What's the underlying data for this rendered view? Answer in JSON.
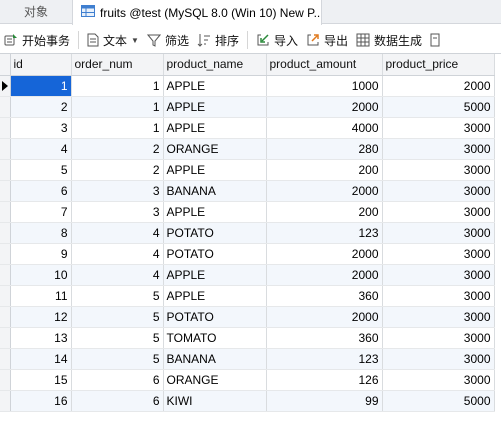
{
  "tabs": {
    "objects_label": "对象",
    "active_title": "fruits @test (MySQL 8.0 (Win 10) New P..."
  },
  "toolbar": {
    "begin_transaction": "开始事务",
    "text": "文本",
    "filter": "筛选",
    "sort": "排序",
    "import": "导入",
    "export": "导出",
    "generate_data": "数据生成"
  },
  "icons": {
    "table": "table-icon",
    "transaction": "transaction-icon",
    "text": "document-icon",
    "filter": "funnel-icon",
    "sort": "sort-icon",
    "import": "import-icon",
    "export": "export-icon",
    "generate": "data-generate-icon",
    "more": "more-icon"
  },
  "colors": {
    "selected_cell": "#1565d8",
    "alt_row": "#f3f7fc"
  },
  "grid": {
    "columns": [
      "id",
      "order_num",
      "product_name",
      "product_amount",
      "product_price"
    ],
    "rows": [
      [
        "1",
        "1",
        "APPLE",
        "1000",
        "2000"
      ],
      [
        "2",
        "1",
        "APPLE",
        "2000",
        "5000"
      ],
      [
        "3",
        "1",
        "APPLE",
        "4000",
        "3000"
      ],
      [
        "4",
        "2",
        "ORANGE",
        "280",
        "3000"
      ],
      [
        "5",
        "2",
        "APPLE",
        "200",
        "3000"
      ],
      [
        "6",
        "3",
        "BANANA",
        "2000",
        "3000"
      ],
      [
        "7",
        "3",
        "APPLE",
        "200",
        "3000"
      ],
      [
        "8",
        "4",
        "POTATO",
        "123",
        "3000"
      ],
      [
        "9",
        "4",
        "POTATO",
        "2000",
        "3000"
      ],
      [
        "10",
        "4",
        "APPLE",
        "2000",
        "3000"
      ],
      [
        "11",
        "5",
        "APPLE",
        "360",
        "3000"
      ],
      [
        "12",
        "5",
        "POTATO",
        "2000",
        "3000"
      ],
      [
        "13",
        "5",
        "TOMATO",
        "360",
        "3000"
      ],
      [
        "14",
        "5",
        "BANANA",
        "123",
        "3000"
      ],
      [
        "15",
        "6",
        "ORANGE",
        "126",
        "3000"
      ],
      [
        "16",
        "6",
        "KIWI",
        "99",
        "5000"
      ]
    ]
  }
}
